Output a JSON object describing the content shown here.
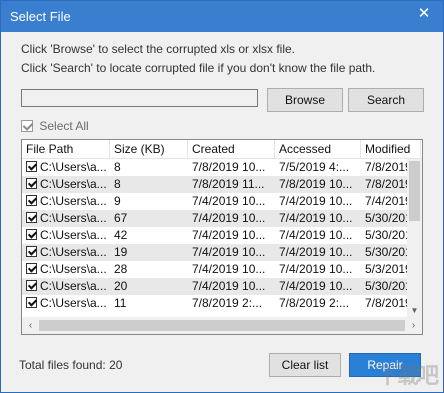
{
  "window": {
    "title": "Select File",
    "close_glyph": "✕"
  },
  "instructions": {
    "line1": "Click 'Browse' to select the corrupted xls or xlsx file.",
    "line2": "Click 'Search' to locate corrupted file if you don't know the file path."
  },
  "path_input": {
    "value": "",
    "placeholder": ""
  },
  "buttons": {
    "browse": "Browse",
    "search": "Search",
    "clear": "Clear list",
    "repair": "Repair"
  },
  "select_all": {
    "label": "Select All",
    "checked": true,
    "enabled": false
  },
  "table": {
    "columns": [
      "File Path",
      "Size (KB)",
      "Created",
      "Accessed",
      "Modified"
    ],
    "rows": [
      {
        "path": "C:\\Users\\a...",
        "size": "8",
        "created": "7/8/2019 10...",
        "accessed": "7/5/2019 4:...",
        "modified": "7/8/2019"
      },
      {
        "path": "C:\\Users\\a...",
        "size": "8",
        "created": "7/8/2019 11...",
        "accessed": "7/8/2019 10...",
        "modified": "7/8/2019"
      },
      {
        "path": "C:\\Users\\a...",
        "size": "9",
        "created": "7/4/2019 10...",
        "accessed": "7/4/2019 10...",
        "modified": "7/4/2019"
      },
      {
        "path": "C:\\Users\\a...",
        "size": "67",
        "created": "7/4/2019 10...",
        "accessed": "7/4/2019 10...",
        "modified": "5/30/201"
      },
      {
        "path": "C:\\Users\\a...",
        "size": "42",
        "created": "7/4/2019 10...",
        "accessed": "7/4/2019 10...",
        "modified": "5/30/201"
      },
      {
        "path": "C:\\Users\\a...",
        "size": "19",
        "created": "7/4/2019 10...",
        "accessed": "7/4/2019 10...",
        "modified": "5/30/201"
      },
      {
        "path": "C:\\Users\\a...",
        "size": "28",
        "created": "7/4/2019 10...",
        "accessed": "7/4/2019 10...",
        "modified": "5/3/2019"
      },
      {
        "path": "C:\\Users\\a...",
        "size": "20",
        "created": "7/4/2019 10...",
        "accessed": "7/4/2019 10...",
        "modified": "5/30/201"
      },
      {
        "path": "C:\\Users\\a...",
        "size": "11",
        "created": "7/8/2019 2:...",
        "accessed": "7/8/2019 2:...",
        "modified": "7/8/2019"
      }
    ]
  },
  "status": {
    "total_label": "Total files found:",
    "total_count": "20"
  },
  "watermark": "下载吧",
  "colors": {
    "titlebar": "#3a7fcf",
    "repair_button": "#2a7fd6",
    "alt_row": "#e8e8e8"
  }
}
